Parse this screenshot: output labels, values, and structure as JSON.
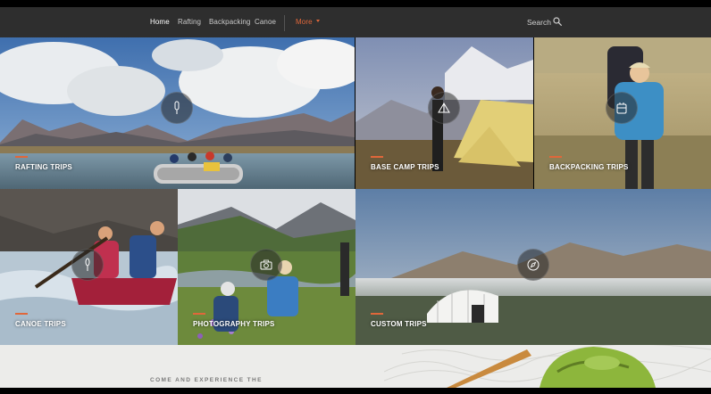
{
  "nav": {
    "items": [
      {
        "label": "Home",
        "active": true
      },
      {
        "label": "Rafting"
      },
      {
        "label": "Backpacking"
      },
      {
        "label": "Canoe"
      }
    ],
    "more_label": "More",
    "search_label": "Search"
  },
  "tiles": {
    "rafting": {
      "label": "Rafting Trips",
      "icon": "paddle-icon"
    },
    "basecamp": {
      "label": "Base Camp Trips",
      "icon": "tent-icon"
    },
    "backpacking": {
      "label": "Backpacking Trips",
      "icon": "backpack-icon"
    },
    "canoe": {
      "label": "Canoe Trips",
      "icon": "canoe-paddle-icon"
    },
    "photography": {
      "label": "Photography Trips",
      "icon": "camera-icon"
    },
    "custom": {
      "label": "Custom Trips",
      "icon": "compass-icon"
    }
  },
  "footer": {
    "tagline": "COME AND EXPERIENCE THE"
  },
  "colors": {
    "accent": "#e0673a",
    "navbar": "#2e2e2e"
  }
}
